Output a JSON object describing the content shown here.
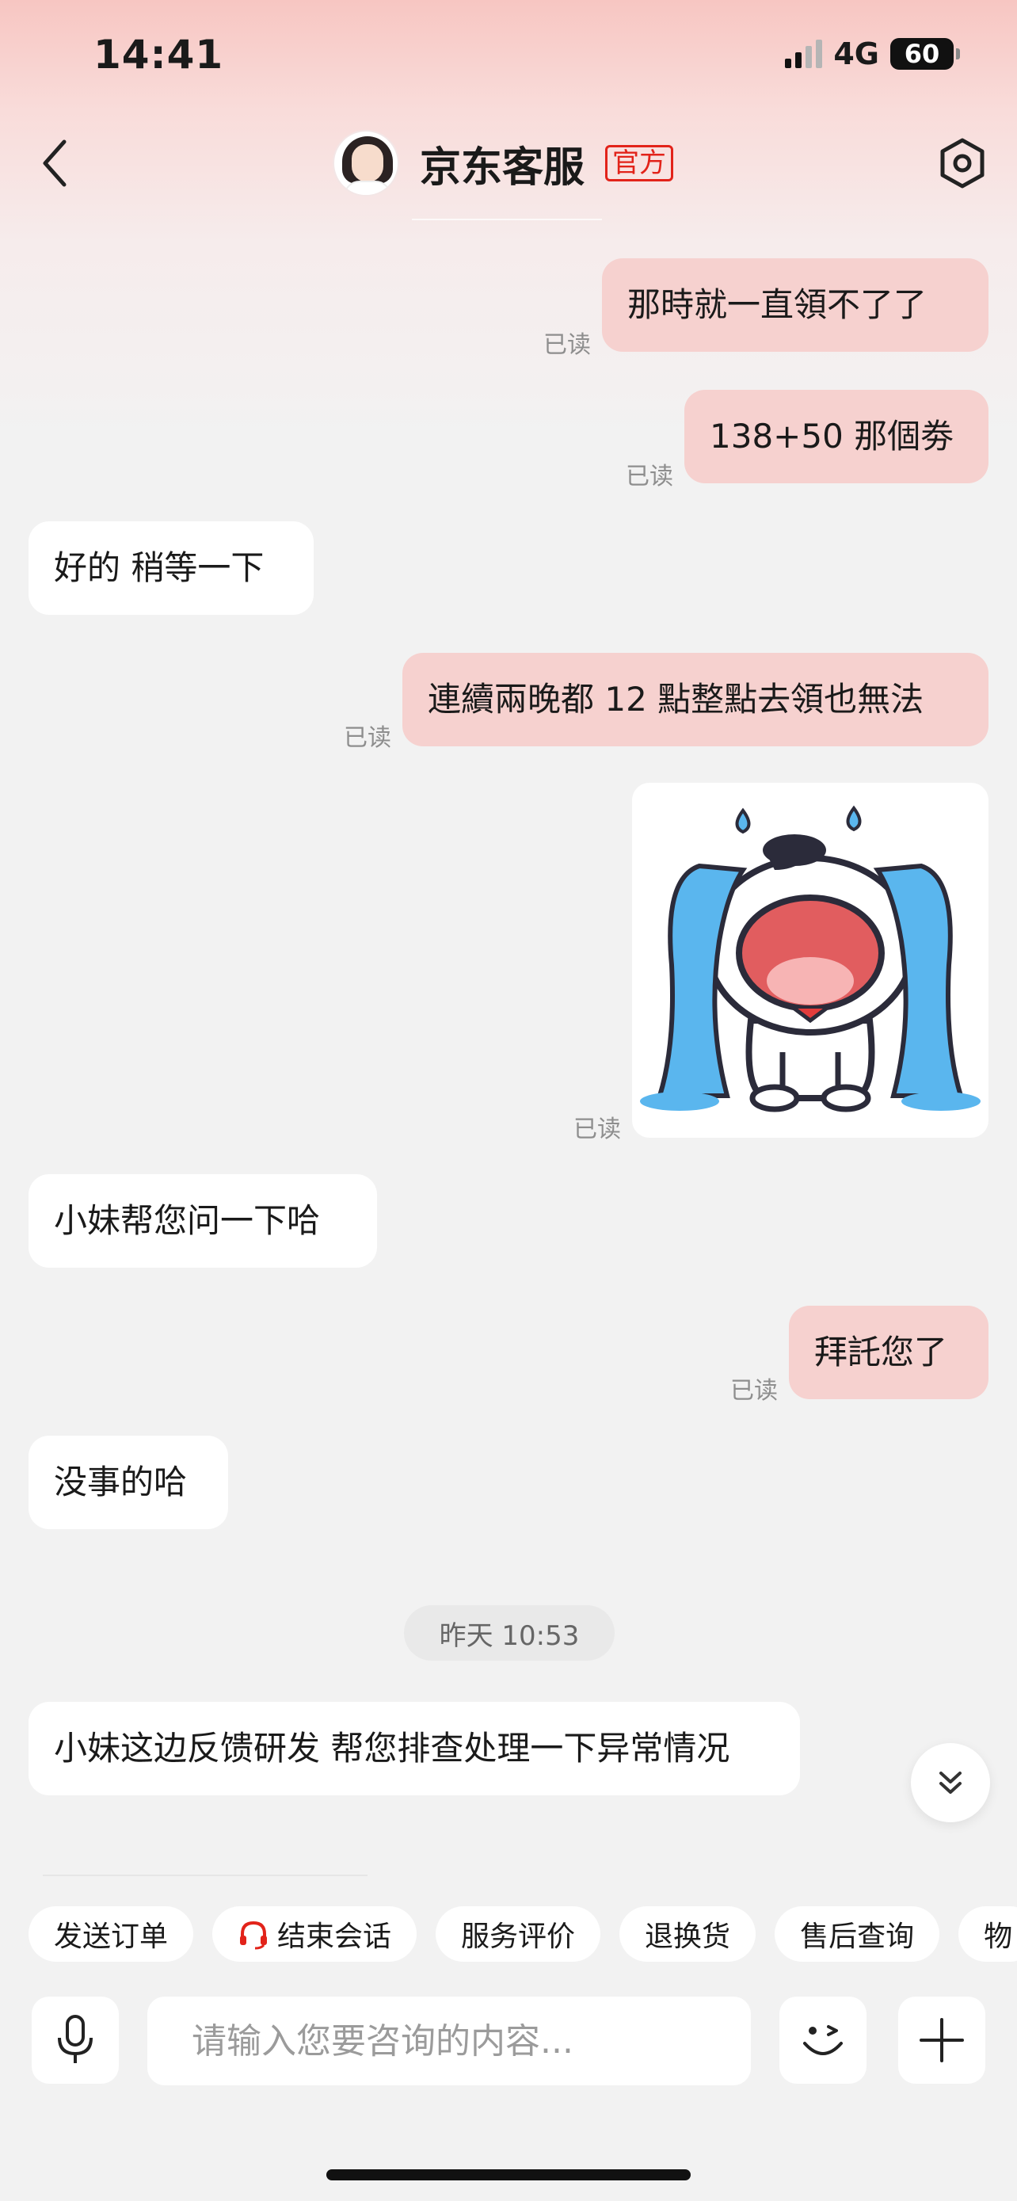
{
  "status_bar": {
    "time": "14:41",
    "network": "4G",
    "battery": "60"
  },
  "header": {
    "title": "京东客服",
    "badge": "官方"
  },
  "messages": [
    {
      "dir": "out",
      "text": "那時就一直領不了了",
      "read": "已读"
    },
    {
      "dir": "out",
      "text": "138+50 那個劵",
      "read": "已读"
    },
    {
      "dir": "in",
      "text": "好的 稍等一下"
    },
    {
      "dir": "out",
      "text": "連續兩晚都 12 點整點去領也無法",
      "read": "已读"
    },
    {
      "dir": "out",
      "type": "sticker",
      "read": "已读"
    },
    {
      "dir": "in",
      "text": "小妹帮您问一下哈"
    },
    {
      "dir": "out",
      "text": "拜託您了",
      "read": "已读"
    },
    {
      "dir": "in",
      "text": "没事的哈"
    },
    {
      "dir": "in",
      "text": "小妹这边反馈研发 帮您排查处理一下异常情况"
    }
  ],
  "timestamp": "昨天 10:53",
  "quick_actions": [
    {
      "label": "发送订单"
    },
    {
      "label": "结束会话",
      "icon": "headset-icon"
    },
    {
      "label": "服务评价"
    },
    {
      "label": "退换货"
    },
    {
      "label": "售后查询"
    },
    {
      "label": "物"
    }
  ],
  "input": {
    "placeholder": "请输入您要咨询的内容..."
  },
  "colors": {
    "outgoing_bubble": "#f6d1cf",
    "incoming_bubble": "#ffffff",
    "badge_red": "#e2231a",
    "background": "#f2f2f2"
  }
}
